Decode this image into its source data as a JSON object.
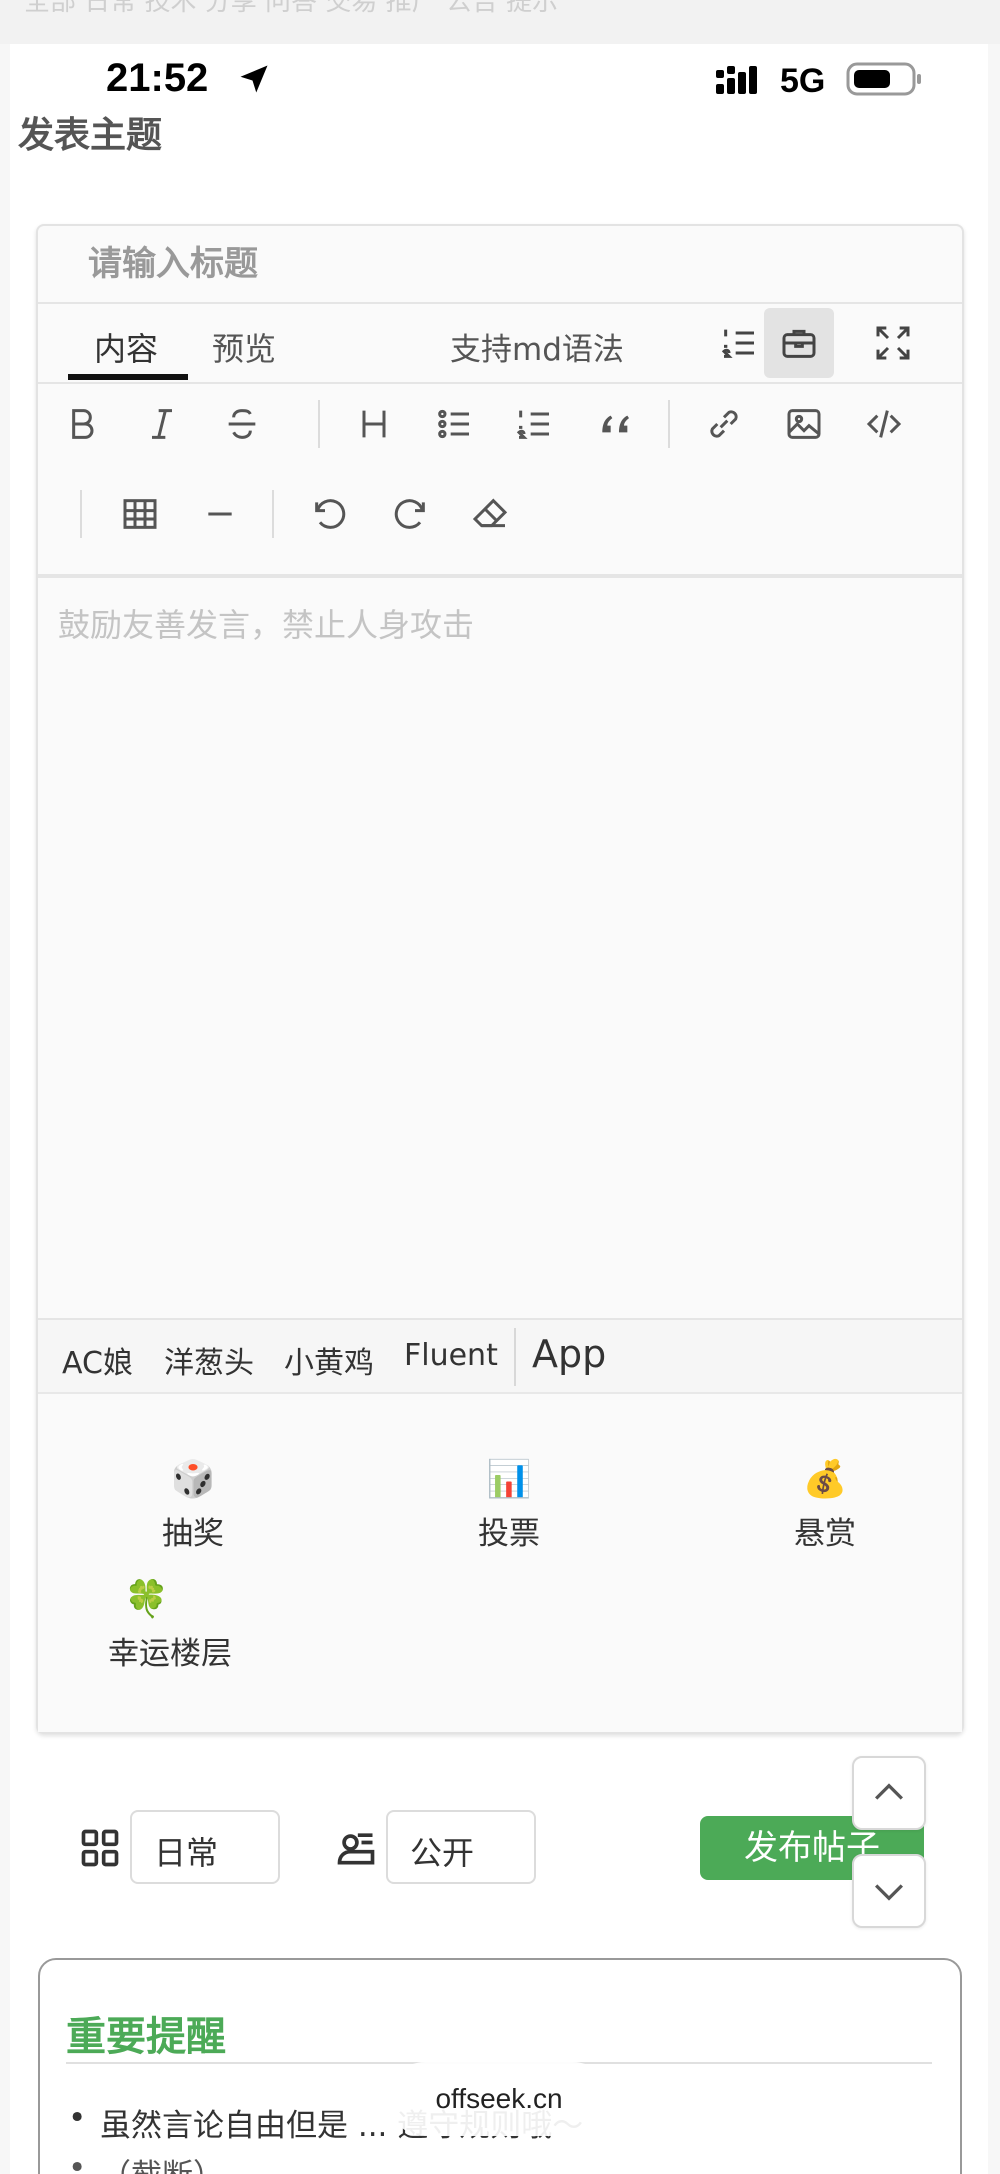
{
  "background_nav": {
    "text": "全部 日常 技术 分享 问答 交易 推广 公告 提示"
  },
  "status_bar": {
    "time": "21:52",
    "network": "5G"
  },
  "page": {
    "title": "发表主题"
  },
  "editor": {
    "title_placeholder": "请输入标题",
    "tabs": {
      "content": "内容",
      "preview": "预览"
    },
    "md_hint": "支持md语法",
    "content_placeholder": "鼓励友善发言，禁止人身攻击",
    "toolbar_icons": [
      "bold-icon",
      "italic-icon",
      "strikethrough-icon",
      "heading-icon",
      "bullet-list-icon",
      "numbered-list-icon",
      "quote-icon",
      "link-icon",
      "image-icon",
      "code-icon",
      "table-icon",
      "horizontal-rule-icon",
      "undo-icon",
      "redo-icon",
      "eraser-icon"
    ]
  },
  "sticker_tabs": [
    "AC娘",
    "洋葱头",
    "小黄鸡",
    "Fluent",
    "App"
  ],
  "tools": [
    {
      "emoji": "🎲",
      "label": "抽奖"
    },
    {
      "emoji": "📊",
      "label": "投票"
    },
    {
      "emoji": "💰",
      "label": "悬赏"
    },
    {
      "emoji": "🍀",
      "label": "幸运楼层"
    }
  ],
  "post_options": {
    "category": "日常",
    "visibility": "公开",
    "publish_label": "发布帖子"
  },
  "notice": {
    "title": "重要提醒",
    "items": [
      "虽然言论自由但是 ... 遵守规则哦～",
      "（截断）"
    ]
  },
  "url_pill": {
    "text": "offseek.cn"
  },
  "colors": {
    "accent": "#4caa57",
    "toolbox_active_bg": "#e3e3e3"
  }
}
